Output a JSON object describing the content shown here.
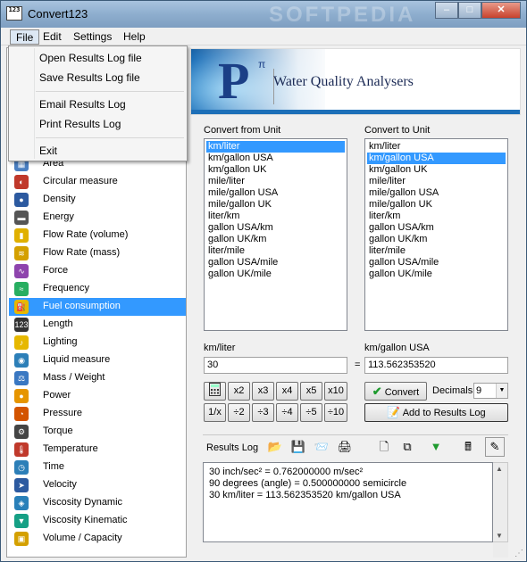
{
  "window": {
    "title": "Convert123",
    "app_icon_text": "123",
    "watermark": "SOFTPEDIA",
    "buttons": {
      "minimize": "–",
      "maximize": "□",
      "close": "✕"
    }
  },
  "menubar": {
    "items": [
      "File",
      "Edit",
      "Settings",
      "Help"
    ]
  },
  "file_menu": {
    "items": [
      "Open Results Log file",
      "Save Results Log file",
      "Email Results Log",
      "Print Results Log",
      "Exit"
    ]
  },
  "banner": {
    "logo_letter": "P",
    "logo_sup": "π",
    "tagline": "Water Quality Analysers"
  },
  "sidebar": {
    "items": [
      {
        "label": "Area",
        "icon": "area-icon",
        "color": "#4a7fc1",
        "glyph": "▦"
      },
      {
        "label": "Circular measure",
        "icon": "circular-measure-icon",
        "color": "#c0392b",
        "glyph": "◐"
      },
      {
        "label": "Density",
        "icon": "density-icon",
        "color": "#2c5aa0",
        "glyph": "●"
      },
      {
        "label": "Energy",
        "icon": "energy-icon",
        "color": "#555555",
        "glyph": "▬"
      },
      {
        "label": "Flow Rate (volume)",
        "icon": "flow-volume-icon",
        "color": "#e0b000",
        "glyph": "▮"
      },
      {
        "label": "Flow Rate (mass)",
        "icon": "flow-mass-icon",
        "color": "#d4a000",
        "glyph": "≋"
      },
      {
        "label": "Force",
        "icon": "force-icon",
        "color": "#8e44ad",
        "glyph": "∿"
      },
      {
        "label": "Frequency",
        "icon": "frequency-icon",
        "color": "#27ae60",
        "glyph": "≈"
      },
      {
        "label": "Fuel consumption",
        "icon": "fuel-icon",
        "color": "#e6b800",
        "glyph": "⛽"
      },
      {
        "label": "Length",
        "icon": "length-icon",
        "color": "#333333",
        "glyph": "123"
      },
      {
        "label": "Lighting",
        "icon": "lighting-icon",
        "color": "#e6b800",
        "glyph": "♪"
      },
      {
        "label": "Liquid measure",
        "icon": "liquid-icon",
        "color": "#2c7fb8",
        "glyph": "◉"
      },
      {
        "label": "Mass / Weight",
        "icon": "mass-icon",
        "color": "#3a78c2",
        "glyph": "⚖"
      },
      {
        "label": "Power",
        "icon": "power-icon",
        "color": "#e69500",
        "glyph": "●"
      },
      {
        "label": "Pressure",
        "icon": "pressure-icon",
        "color": "#d35400",
        "glyph": "◔"
      },
      {
        "label": "Torque",
        "icon": "torque-icon",
        "color": "#444444",
        "glyph": "⚙"
      },
      {
        "label": "Temperature",
        "icon": "temperature-icon",
        "color": "#c0392b",
        "glyph": "🌡"
      },
      {
        "label": "Time",
        "icon": "time-icon",
        "color": "#2c7fb8",
        "glyph": "◷"
      },
      {
        "label": "Velocity",
        "icon": "velocity-icon",
        "color": "#2c5aa0",
        "glyph": "➤"
      },
      {
        "label": "Viscosity Dynamic",
        "icon": "viscosity-dynamic-icon",
        "color": "#2980b9",
        "glyph": "◈"
      },
      {
        "label": "Viscosity Kinematic",
        "icon": "viscosity-kinematic-icon",
        "color": "#16a085",
        "glyph": "▼"
      },
      {
        "label": "Volume / Capacity",
        "icon": "volume-icon",
        "color": "#d4a000",
        "glyph": "▣"
      }
    ],
    "selected_index": 8
  },
  "convert_from": {
    "label": "Convert from Unit",
    "units": [
      "km/liter",
      "km/gallon USA",
      "km/gallon UK",
      "mile/liter",
      "mile/gallon USA",
      "mile/gallon UK",
      "liter/km",
      "gallon USA/km",
      "gallon UK/km",
      "liter/mile",
      "gallon USA/mile",
      "gallon UK/mile"
    ],
    "selected_index": 0,
    "value_label": "km/liter",
    "value": "30"
  },
  "convert_to": {
    "label": "Convert to Unit",
    "units": [
      "km/liter",
      "km/gallon USA",
      "km/gallon UK",
      "mile/liter",
      "mile/gallon USA",
      "mile/gallon UK",
      "liter/km",
      "gallon USA/km",
      "gallon UK/km",
      "liter/mile",
      "gallon USA/mile",
      "gallon UK/mile"
    ],
    "selected_index": 1,
    "value_label": "km/gallon USA",
    "value": "113.562353520"
  },
  "equals": "=",
  "calc_buttons": {
    "row1": [
      "x2",
      "x3",
      "x4",
      "x5",
      "x10"
    ],
    "row2": [
      "1/x",
      "÷2",
      "÷3",
      "÷4",
      "÷5",
      "÷10"
    ]
  },
  "convert_button": "Convert",
  "decimals": {
    "label": "Decimals",
    "value": "9"
  },
  "add_to_log_button": "Add to Results Log",
  "results_log": {
    "label": "Results Log",
    "lines": [
      "30 inch/sec² = 0.762000000 m/sec²",
      "90 degrees (angle) = 0.500000000 semicircle",
      "30 km/liter = 113.562353520 km/gallon USA"
    ]
  },
  "accent_color": "#3399ff"
}
